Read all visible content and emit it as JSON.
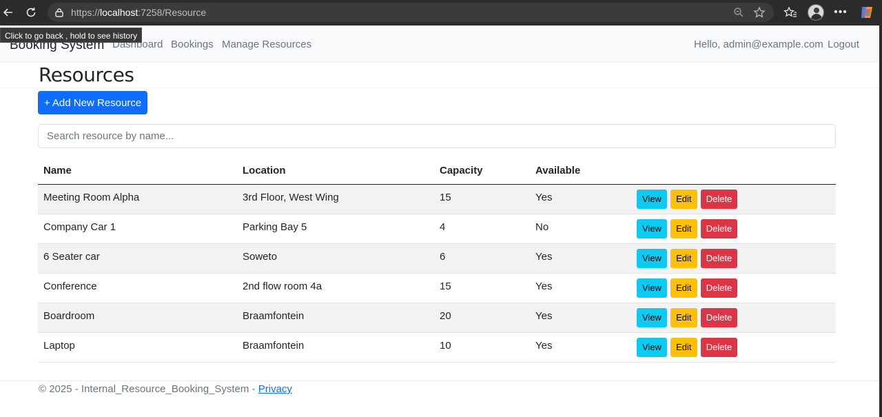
{
  "browser": {
    "url_prefix": "https://",
    "url_host": "localhost",
    "url_rest": ":7258/Resource",
    "tooltip": "Click to go back , hold to see history"
  },
  "nav": {
    "brand": "Booking System",
    "links": [
      "Dashboard",
      "Bookings",
      "Manage Resources"
    ],
    "hello": "Hello, admin@example.com",
    "logout": "Logout"
  },
  "page": {
    "title": "Resources",
    "add_button": "+ Add New Resource",
    "search_placeholder": "Search resource by name..."
  },
  "table": {
    "headers": [
      "Name",
      "Location",
      "Capacity",
      "Available"
    ],
    "rows": [
      [
        "Meeting Room Alpha",
        "3rd Floor, West Wing",
        "15",
        "Yes"
      ],
      [
        "Company Car 1",
        "Parking Bay 5",
        "4",
        "No"
      ],
      [
        "6 Seater car",
        "Soweto",
        "6",
        "Yes"
      ],
      [
        "Conference",
        "2nd flow room 4a",
        "15",
        "Yes"
      ],
      [
        "Boardroom",
        "Braamfontein",
        "20",
        "Yes"
      ],
      [
        "Laptop",
        "Braamfontein",
        "10",
        "Yes"
      ]
    ],
    "actions": {
      "view": "View",
      "edit": "Edit",
      "delete": "Delete"
    }
  },
  "footer": {
    "text": "© 2025 - Internal_Resource_Booking_System - ",
    "privacy": "Privacy"
  },
  "colors": {
    "primary": "#0d6efd",
    "info": "#0dcaf0",
    "warning": "#ffc107",
    "danger": "#dc3545"
  }
}
